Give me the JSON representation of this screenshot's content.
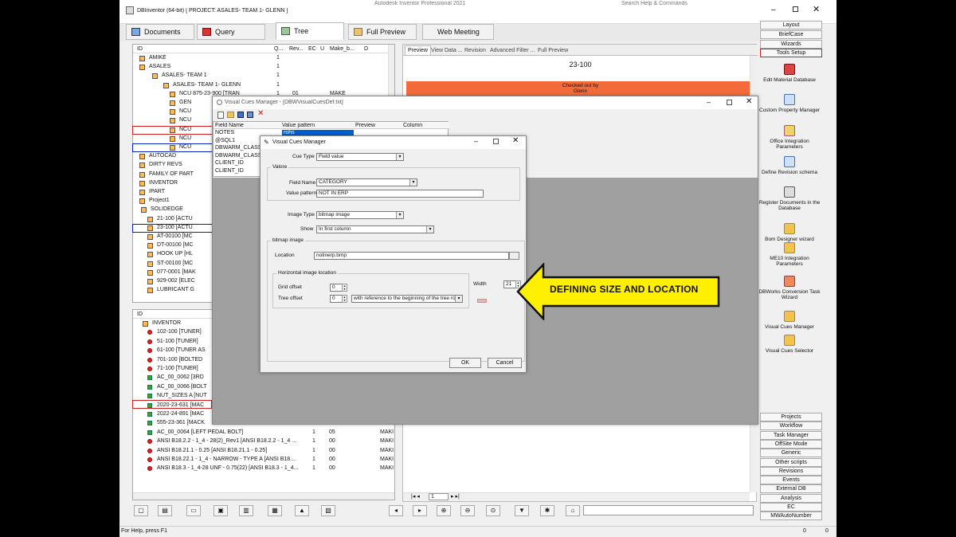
{
  "app": {
    "title": "DBInventor (64-bit) [ PROJECT: ASALES- TEAM 1- GLENN ]",
    "center_title": "Autodesk Inventor Professional 2021",
    "search": "Search Help & Commands",
    "status": "For Help, press F1",
    "status_right": [
      "0",
      "0"
    ]
  },
  "tabs": [
    {
      "label": "Documents"
    },
    {
      "label": "Query"
    },
    {
      "label": "Tree"
    },
    {
      "label": "Full Preview"
    },
    {
      "label": "Web Meeting"
    }
  ],
  "tree_top": {
    "headers": [
      "ID",
      "Q...",
      "Rev...",
      "EC",
      "U",
      "Make_b...",
      "D"
    ],
    "rows": [
      [
        "AMIKE",
        "1"
      ],
      [
        "ASALES",
        "1"
      ],
      [
        "ASALES- TEAM 1",
        "1"
      ],
      [
        "ASALES- TEAM 1- GLENN",
        "1"
      ],
      [
        "NCU 875-23-900 [TRAN",
        "1"
      ],
      [
        "GEN",
        ""
      ],
      [
        "NCU",
        ""
      ],
      [
        "NCU",
        ""
      ],
      [
        "NCU",
        ""
      ],
      [
        "NCU",
        ""
      ],
      [
        "NCU",
        ""
      ],
      [
        "AUTOCAD",
        ""
      ],
      [
        "DIRTY REVS",
        ""
      ],
      [
        "FAMILY OF PART",
        ""
      ],
      [
        "INVENTOR",
        ""
      ],
      [
        "IPART",
        ""
      ],
      [
        "Project1",
        ""
      ],
      [
        "SOLIDEDGE",
        ""
      ],
      [
        "21-100 [ACTU",
        ""
      ],
      [
        "23-100 [ACTU",
        ""
      ],
      [
        "AT-00100 [MC",
        ""
      ],
      [
        "DT-00100 [MC",
        ""
      ],
      [
        "HOOK UP [HL",
        ""
      ],
      [
        "ST-00100 [MC",
        ""
      ],
      [
        "077-0001 [MAK",
        ""
      ],
      [
        "929-002 [ELEC",
        ""
      ],
      [
        "LUBRICANT G",
        ""
      ]
    ],
    "row_vals": {
      "rev": "01",
      "make": "MAKE"
    }
  },
  "tree_bottom": {
    "header": "ID",
    "rows": [
      [
        "INVENTOR",
        "",
        "",
        ""
      ],
      [
        "102-100 [TUNER]",
        "",
        "",
        ""
      ],
      [
        "51-100 [TUNER]",
        "",
        "",
        ""
      ],
      [
        "61-100 [TUNER AS",
        "",
        "",
        ""
      ],
      [
        "701-100 [BOLTED",
        "",
        "",
        ""
      ],
      [
        "71-100 [TUNER]",
        "",
        "",
        ""
      ],
      [
        "AC_00_0062 [3RD",
        "",
        "",
        ""
      ],
      [
        "AC_00_0066 [BOLT",
        "",
        "",
        ""
      ],
      [
        "NUT_SIZES A [NUT",
        "",
        "",
        ""
      ],
      [
        "2020-23-631 [MAC",
        "",
        "",
        ""
      ],
      [
        "2022-24-891 [MAC",
        "",
        "",
        ""
      ],
      [
        "555-23-361 [MACK",
        "",
        "",
        ""
      ],
      [
        "AC_00_0064 [LEFT PEDAL BOLT]",
        "1",
        "05",
        "MAKI"
      ],
      [
        "ANSI B18.2.2 - 1_4 - 28(2)_Rev1 [ANSI B18.2.2 - 1_4 ...",
        "1",
        "00",
        "MAKI"
      ],
      [
        "ANSI B18.21.1 - 0.25 [ANSI B18.21.1 - 0.25]",
        "1",
        "00",
        "MAKI"
      ],
      [
        "ANSI B18.22.1 - 1_4 - NARROW - TYPE A [ANSI B18....",
        "1",
        "00",
        "MAKI"
      ],
      [
        "ANSI B18.3 - 1_4-28 UNF - 0.75(22) [ANSI B18.3 - 1_4...",
        "1",
        "00",
        "MAKI"
      ]
    ]
  },
  "preview": {
    "tabs": [
      "Preview",
      "View Data ...",
      "Revision",
      "Advanced Filter ...",
      "Full Preview"
    ],
    "item": "23-100",
    "checkout": "Checked out by",
    "checkout_user": "Glenn",
    "page": "1"
  },
  "right_top": [
    "Layout",
    "BriefCase",
    "Wizards",
    "Tools Setup"
  ],
  "right_tools": [
    "Edit Material Database",
    "Custom Property Manager",
    "Office Integration Parameters",
    "Define Revision schema",
    "Register Documents in the Database",
    "Bom Designer wizard",
    "ME10 Integration Parameters",
    "DBWorks Conversion Task Wizard",
    "Visual Cues Manager",
    "Visual Cues Selector"
  ],
  "right_bottom": [
    "Projects",
    "Workflow",
    "Task Manager",
    "OffSite Mode",
    "Generic",
    "Other scripts",
    "Revisions",
    "Events",
    "External DB",
    "Analysis",
    "EC",
    "MWAutoNumber"
  ],
  "vcm_outer": {
    "title": "Visual Cues Manager - [DBWVisualCuesDef.txt]",
    "headers": [
      "Field Name",
      "Value pattern",
      "Preview",
      "Column"
    ],
    "rows": [
      [
        "NOTES",
        "rohs"
      ],
      [
        "@SQL1",
        ""
      ],
      [
        "DBWARM_CLASS",
        ""
      ],
      [
        "DBWARM_CLASS",
        ""
      ],
      [
        "CLIENT_ID",
        ""
      ],
      [
        "CLIENT_ID",
        ""
      ]
    ]
  },
  "vcm": {
    "title": "Visual Cues Manager",
    "cue_type_label": "Cue Type",
    "cue_type": "Field value",
    "values_group": "Valore",
    "field_name_label": "Field Name",
    "field_name": "CATEGORY",
    "value_pattern_label": "Value pattern",
    "value_pattern": "NOT IN ERP",
    "image_type_label": "Image Type",
    "image_type": "bitmap image",
    "show_label": "Show",
    "show": "In first column",
    "bitmap_group": "bitmap image",
    "location_label": "Location",
    "location": "notinerp.bmp",
    "horiz_group": "Horizontal image location",
    "grid_offset_label": "Grid offset",
    "grid_offset": "0",
    "tree_offset_label": "Tree offset",
    "tree_offset": "0",
    "tree_ref": "with reference to the beginning of the tree row",
    "width_label": "Width",
    "width": "21",
    "ok": "OK",
    "cancel": "Cancel"
  },
  "callout": "DEFINING SIZE AND LOCATION",
  "colors": {
    "accent": "#f26b3a",
    "callout": "#ffef00",
    "highlight_red": "#d21d1d",
    "highlight_blue": "#0020c0"
  }
}
